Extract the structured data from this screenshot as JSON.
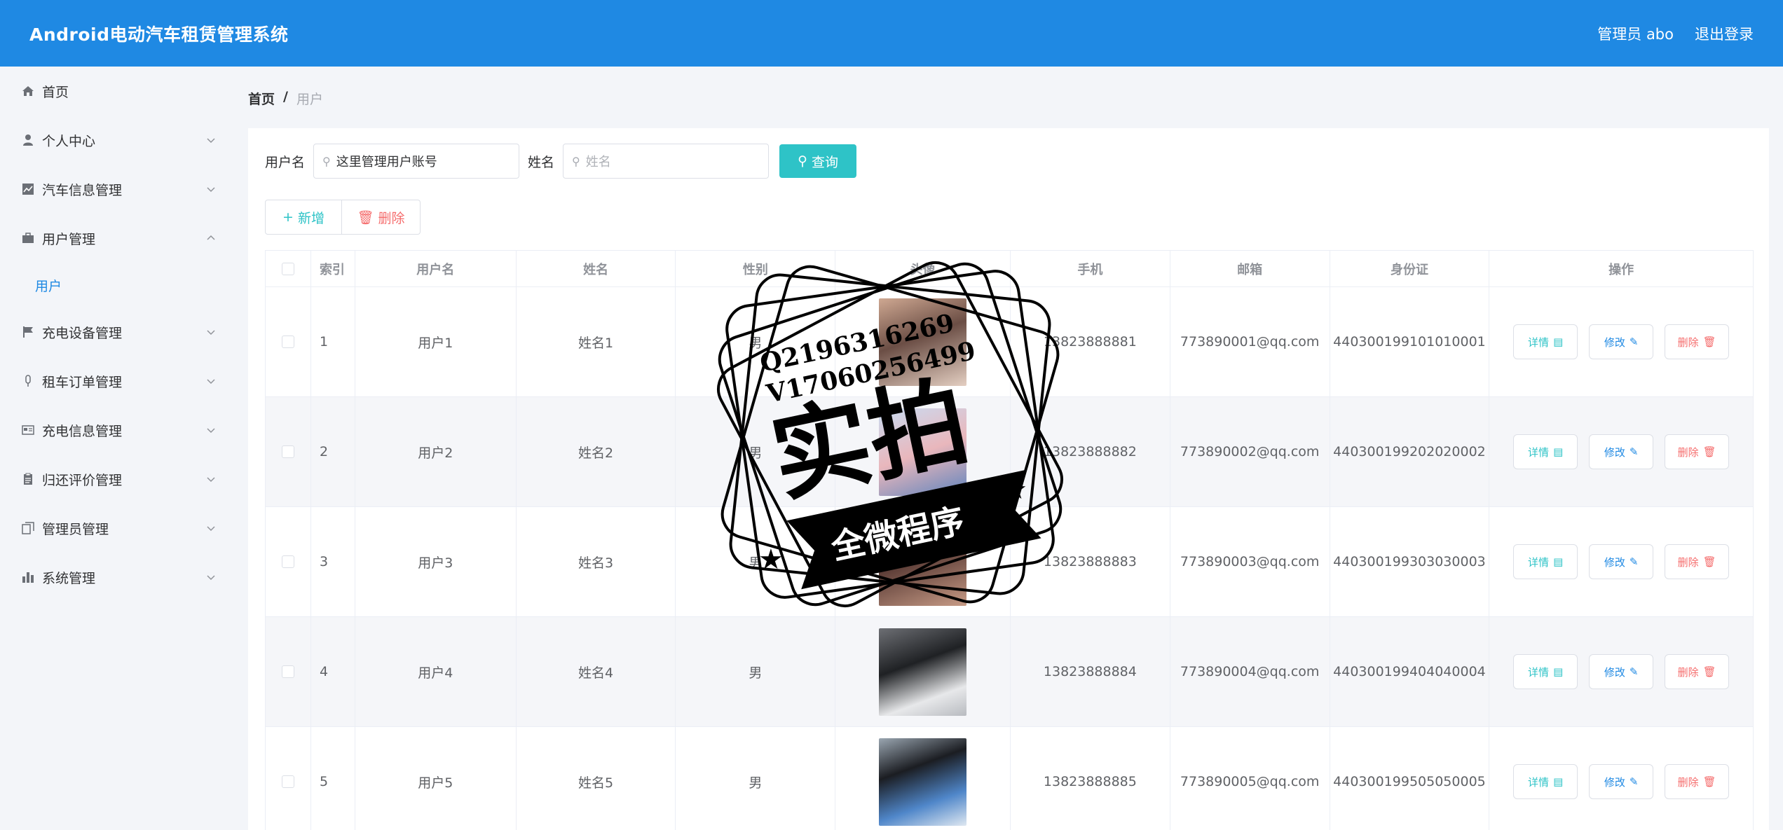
{
  "header": {
    "title": "Android电动汽车租赁管理系统",
    "admin_label": "管理员 abo",
    "logout_label": "退出登录"
  },
  "sidebar": {
    "items": [
      {
        "label": "首页",
        "icon": "home-icon"
      },
      {
        "label": "个人中心",
        "icon": "user-icon"
      },
      {
        "label": "汽车信息管理",
        "icon": "chart-icon"
      },
      {
        "label": "用户管理",
        "icon": "briefcase-icon",
        "expanded": true,
        "children": [
          {
            "label": "用户"
          }
        ]
      },
      {
        "label": "充电设备管理",
        "icon": "flag-icon"
      },
      {
        "label": "租车订单管理",
        "icon": "mic-icon"
      },
      {
        "label": "充电信息管理",
        "icon": "postcard-icon"
      },
      {
        "label": "归还评价管理",
        "icon": "clipboard-icon"
      },
      {
        "label": "管理员管理",
        "icon": "copy-icon"
      },
      {
        "label": "系统管理",
        "icon": "bar-chart-icon"
      }
    ]
  },
  "breadcrumb": {
    "home": "首页",
    "separator": "/",
    "current": "用户"
  },
  "search": {
    "username_label": "用户名",
    "username_value": "这里管理用户账号",
    "name_label": "姓名",
    "name_placeholder": "姓名",
    "query_label": "查询"
  },
  "actions": {
    "add_label": "新增",
    "delete_label": "删除"
  },
  "table": {
    "headers": [
      "索引",
      "用户名",
      "姓名",
      "性别",
      "头像",
      "手机",
      "邮箱",
      "身份证",
      "操作"
    ],
    "rows": [
      {
        "index": "1",
        "username": "用户1",
        "name": "姓名1",
        "sex": "男",
        "phone": "13823888881",
        "email": "773890001@qq.com",
        "id_card": "440300199101010001"
      },
      {
        "index": "2",
        "username": "用户2",
        "name": "姓名2",
        "sex": "男",
        "phone": "13823888882",
        "email": "773890002@qq.com",
        "id_card": "440300199202020002"
      },
      {
        "index": "3",
        "username": "用户3",
        "name": "姓名3",
        "sex": "男",
        "phone": "13823888883",
        "email": "773890003@qq.com",
        "id_card": "440300199303030003"
      },
      {
        "index": "4",
        "username": "用户4",
        "name": "姓名4",
        "sex": "男",
        "phone": "13823888884",
        "email": "773890004@qq.com",
        "id_card": "440300199404040004"
      },
      {
        "index": "5",
        "username": "用户5",
        "name": "姓名5",
        "sex": "男",
        "phone": "13823888885",
        "email": "773890005@qq.com",
        "id_card": "440300199505050005"
      }
    ],
    "op_labels": {
      "detail": "详情",
      "edit": "修改",
      "delete": "删除"
    }
  },
  "watermark": {
    "line1": "Q2196316269",
    "line2": "V17060256499",
    "big": "实拍",
    "banner": "全微程序"
  },
  "colors": {
    "header": "#1f89e3",
    "accent": "#2ec3c7",
    "danger": "#f56c6c",
    "link": "#1f89e3"
  }
}
